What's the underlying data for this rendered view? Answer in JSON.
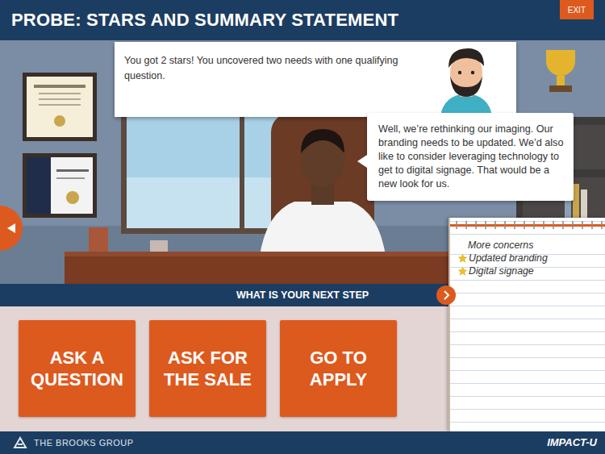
{
  "header": {
    "title": "PROBE: STARS AND SUMMARY STATEMENT",
    "exit": "EXIT"
  },
  "feedback": {
    "text": "You got 2 stars! You uncovered two needs with one qualifying question."
  },
  "speech": {
    "text": "Well, we’re rethinking our imaging. Our branding needs to be updated. We’d also like to consider leveraging technology to get to digital signage. That would be a new look for us."
  },
  "notepad": {
    "title": "More concerns",
    "items": [
      {
        "label": "Updated branding",
        "starred": true
      },
      {
        "label": "Digital signage",
        "starred": true
      }
    ]
  },
  "prompt": {
    "label": "WHAT IS YOUR NEXT STEP"
  },
  "actions": [
    {
      "label": "ASK A QUESTION"
    },
    {
      "label": "ASK FOR THE SALE"
    },
    {
      "label": "GO TO APPLY"
    }
  ],
  "footer": {
    "brand": "THE BROOKS GROUP",
    "product": "IMPACT-U"
  }
}
